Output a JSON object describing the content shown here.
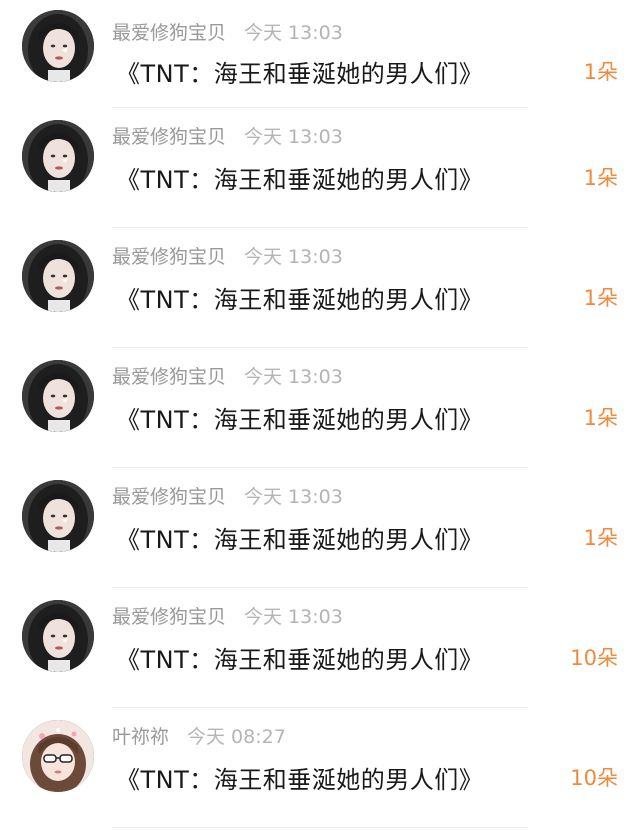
{
  "colors": {
    "count": "#f08a3c",
    "username": "#9a9a9a",
    "time": "#b4b4b4",
    "title": "#1a1a1a",
    "divider": "#ededed"
  },
  "items": [
    {
      "avatar": "girl-avatar-dark",
      "username": "最爱修狗宝贝",
      "time": "今天 13:03",
      "title": "《TNT：海王和垂涎她的男人们》",
      "count": "1朵"
    },
    {
      "avatar": "girl-avatar-dark",
      "username": "最爱修狗宝贝",
      "time": "今天 13:03",
      "title": "《TNT：海王和垂涎她的男人们》",
      "count": "1朵"
    },
    {
      "avatar": "girl-avatar-dark",
      "username": "最爱修狗宝贝",
      "time": "今天 13:03",
      "title": "《TNT：海王和垂涎她的男人们》",
      "count": "1朵"
    },
    {
      "avatar": "girl-avatar-dark",
      "username": "最爱修狗宝贝",
      "time": "今天 13:03",
      "title": "《TNT：海王和垂涎她的男人们》",
      "count": "1朵"
    },
    {
      "avatar": "girl-avatar-dark",
      "username": "最爱修狗宝贝",
      "time": "今天 13:03",
      "title": "《TNT：海王和垂涎她的男人们》",
      "count": "1朵"
    },
    {
      "avatar": "girl-avatar-dark",
      "username": "最爱修狗宝贝",
      "time": "今天 13:03",
      "title": "《TNT：海王和垂涎她的男人们》",
      "count": "10朵"
    },
    {
      "avatar": "girl-avatar-sunglasses",
      "username": "叶祢祢",
      "time": "今天 08:27",
      "title": "《TNT：海王和垂涎她的男人们》",
      "count": "10朵"
    }
  ]
}
